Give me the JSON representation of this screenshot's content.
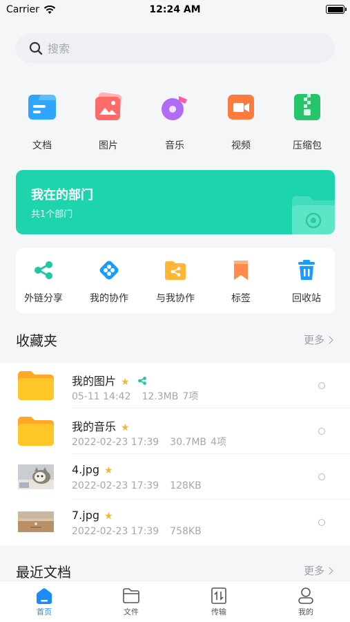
{
  "status_bar": {
    "carrier": "Carrier",
    "time": "12:24 AM"
  },
  "search": {
    "placeholder": "搜索"
  },
  "categories": [
    {
      "label": "文档",
      "icon": "document-icon",
      "color": "#2ea6ff"
    },
    {
      "label": "图片",
      "icon": "image-icon",
      "color": "#ff6b6b"
    },
    {
      "label": "音乐",
      "icon": "music-icon",
      "color": "#b06cf5"
    },
    {
      "label": "视频",
      "icon": "video-icon",
      "color": "#ff7a3d"
    },
    {
      "label": "压缩包",
      "icon": "archive-icon",
      "color": "#27c56b"
    }
  ],
  "department": {
    "title": "我在的部门",
    "subtitle": "共1个部门",
    "color": "#1ed4ad"
  },
  "actions": [
    {
      "label": "外链分享",
      "icon": "share-link-icon",
      "color": "#1ec9a0"
    },
    {
      "label": "我的协作",
      "icon": "collaboration-icon",
      "color": "#1a9cff"
    },
    {
      "label": "与我协作",
      "icon": "shared-folder-icon",
      "color": "#ffb536"
    },
    {
      "label": "标签",
      "icon": "bookmark-icon",
      "color": "#ff8a4c"
    },
    {
      "label": "回收站",
      "icon": "trash-icon",
      "color": "#1a9cff"
    }
  ],
  "favorites": {
    "title": "收藏夹",
    "more": "更多",
    "items": [
      {
        "name": "我的图片",
        "date": "05-11 14:42",
        "size": "12.3MB",
        "count": "7项",
        "type": "folder",
        "starred": true,
        "shared": true
      },
      {
        "name": "我的音乐",
        "date": "2022-02-23 17:39",
        "size": "30.7MB",
        "count": "4项",
        "type": "folder",
        "starred": true,
        "shared": false
      },
      {
        "name": "4.jpg",
        "date": "2022-02-23 17:39",
        "size": "128KB",
        "count": "",
        "type": "image-cat",
        "starred": true,
        "shared": false
      },
      {
        "name": "7.jpg",
        "date": "2022-02-23 17:39",
        "size": "758KB",
        "count": "",
        "type": "image-beach",
        "starred": true,
        "shared": false
      }
    ]
  },
  "recent": {
    "title": "最近文档",
    "more": "更多"
  },
  "tabbar": [
    {
      "label": "首页",
      "icon": "home-icon",
      "active": true
    },
    {
      "label": "文件",
      "icon": "folder-icon",
      "active": false
    },
    {
      "label": "传输",
      "icon": "transfer-icon",
      "active": false
    },
    {
      "label": "我的",
      "icon": "profile-icon",
      "active": false
    }
  ],
  "colors": {
    "accent": "#1a8cff",
    "star": "#f7b52c",
    "folder": "#ffc627"
  }
}
